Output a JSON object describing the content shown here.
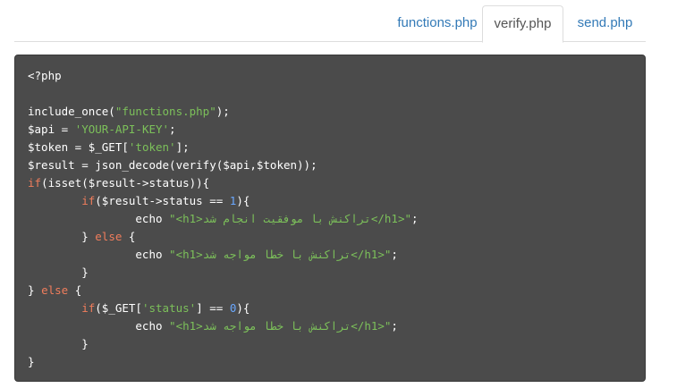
{
  "tabs": [
    {
      "label": "functions.php",
      "active": false
    },
    {
      "label": "verify.php",
      "active": true
    },
    {
      "label": "send.php",
      "active": false
    }
  ],
  "code_lines": [
    [
      {
        "t": "<?php",
        "c": "plain"
      }
    ],
    [],
    [
      {
        "t": "include_once(",
        "c": "plain"
      },
      {
        "t": "\"functions.php\"",
        "c": "str"
      },
      {
        "t": ");",
        "c": "plain"
      }
    ],
    [
      {
        "t": "$api = ",
        "c": "plain"
      },
      {
        "t": "'YOUR-API-KEY'",
        "c": "str"
      },
      {
        "t": ";",
        "c": "plain"
      }
    ],
    [
      {
        "t": "$token = $_GET[",
        "c": "plain"
      },
      {
        "t": "'token'",
        "c": "str"
      },
      {
        "t": "];",
        "c": "plain"
      }
    ],
    [
      {
        "t": "$result = json_decode(verify($api,$token));",
        "c": "plain"
      }
    ],
    [
      {
        "t": "if",
        "c": "kw"
      },
      {
        "t": "(isset($result->status)){",
        "c": "plain"
      }
    ],
    [
      {
        "t": "        ",
        "c": "plain"
      },
      {
        "t": "if",
        "c": "kw"
      },
      {
        "t": "($result->status == ",
        "c": "plain"
      },
      {
        "t": "1",
        "c": "num"
      },
      {
        "t": "){",
        "c": "plain"
      }
    ],
    [
      {
        "t": "                echo ",
        "c": "plain"
      },
      {
        "t": "\"<h1>تراکنش با موفقیت انجام شد</h1>\"",
        "c": "str"
      },
      {
        "t": ";",
        "c": "plain"
      }
    ],
    [
      {
        "t": "        } ",
        "c": "plain"
      },
      {
        "t": "else",
        "c": "kw"
      },
      {
        "t": " {",
        "c": "plain"
      }
    ],
    [
      {
        "t": "                echo ",
        "c": "plain"
      },
      {
        "t": "\"<h1>تراکنش با خطا مواجه شد</h1>\"",
        "c": "str"
      },
      {
        "t": ";",
        "c": "plain"
      }
    ],
    [
      {
        "t": "        }",
        "c": "plain"
      }
    ],
    [
      {
        "t": "} ",
        "c": "plain"
      },
      {
        "t": "else",
        "c": "kw"
      },
      {
        "t": " {",
        "c": "plain"
      }
    ],
    [
      {
        "t": "        ",
        "c": "plain"
      },
      {
        "t": "if",
        "c": "kw"
      },
      {
        "t": "($_GET[",
        "c": "plain"
      },
      {
        "t": "'status'",
        "c": "str"
      },
      {
        "t": "] == ",
        "c": "plain"
      },
      {
        "t": "0",
        "c": "num"
      },
      {
        "t": "){",
        "c": "plain"
      }
    ],
    [
      {
        "t": "                echo ",
        "c": "plain"
      },
      {
        "t": "\"<h1>تراکنش با خطا مواجه شد</h1>\"",
        "c": "str"
      },
      {
        "t": ";",
        "c": "plain"
      }
    ],
    [
      {
        "t": "        }",
        "c": "plain"
      }
    ],
    [
      {
        "t": "}",
        "c": "plain"
      }
    ]
  ],
  "colors": {
    "keyword": "#f07d5c",
    "string": "#7cc05a",
    "number": "#6aa8ff",
    "code_bg": "#4b4b4b",
    "tab_link": "#337ab7"
  }
}
